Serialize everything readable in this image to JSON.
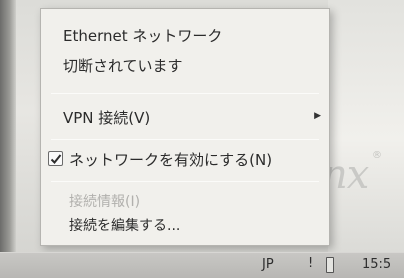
{
  "menu": {
    "header": "Ethernet ネットワーク",
    "status": "切断されています",
    "vpn_label": "VPN 接続(V)",
    "enable_network_label": "ネットワークを有効にする(N)",
    "enable_network_checked": true,
    "connection_info_label": "接続情報(I)",
    "edit_connections_label": "接続を編集する..."
  },
  "taskbar": {
    "keyboard_layout": "JP",
    "clock": "15:5"
  },
  "desktop": {
    "brand_partial": "nx",
    "brand_mark": "®"
  }
}
